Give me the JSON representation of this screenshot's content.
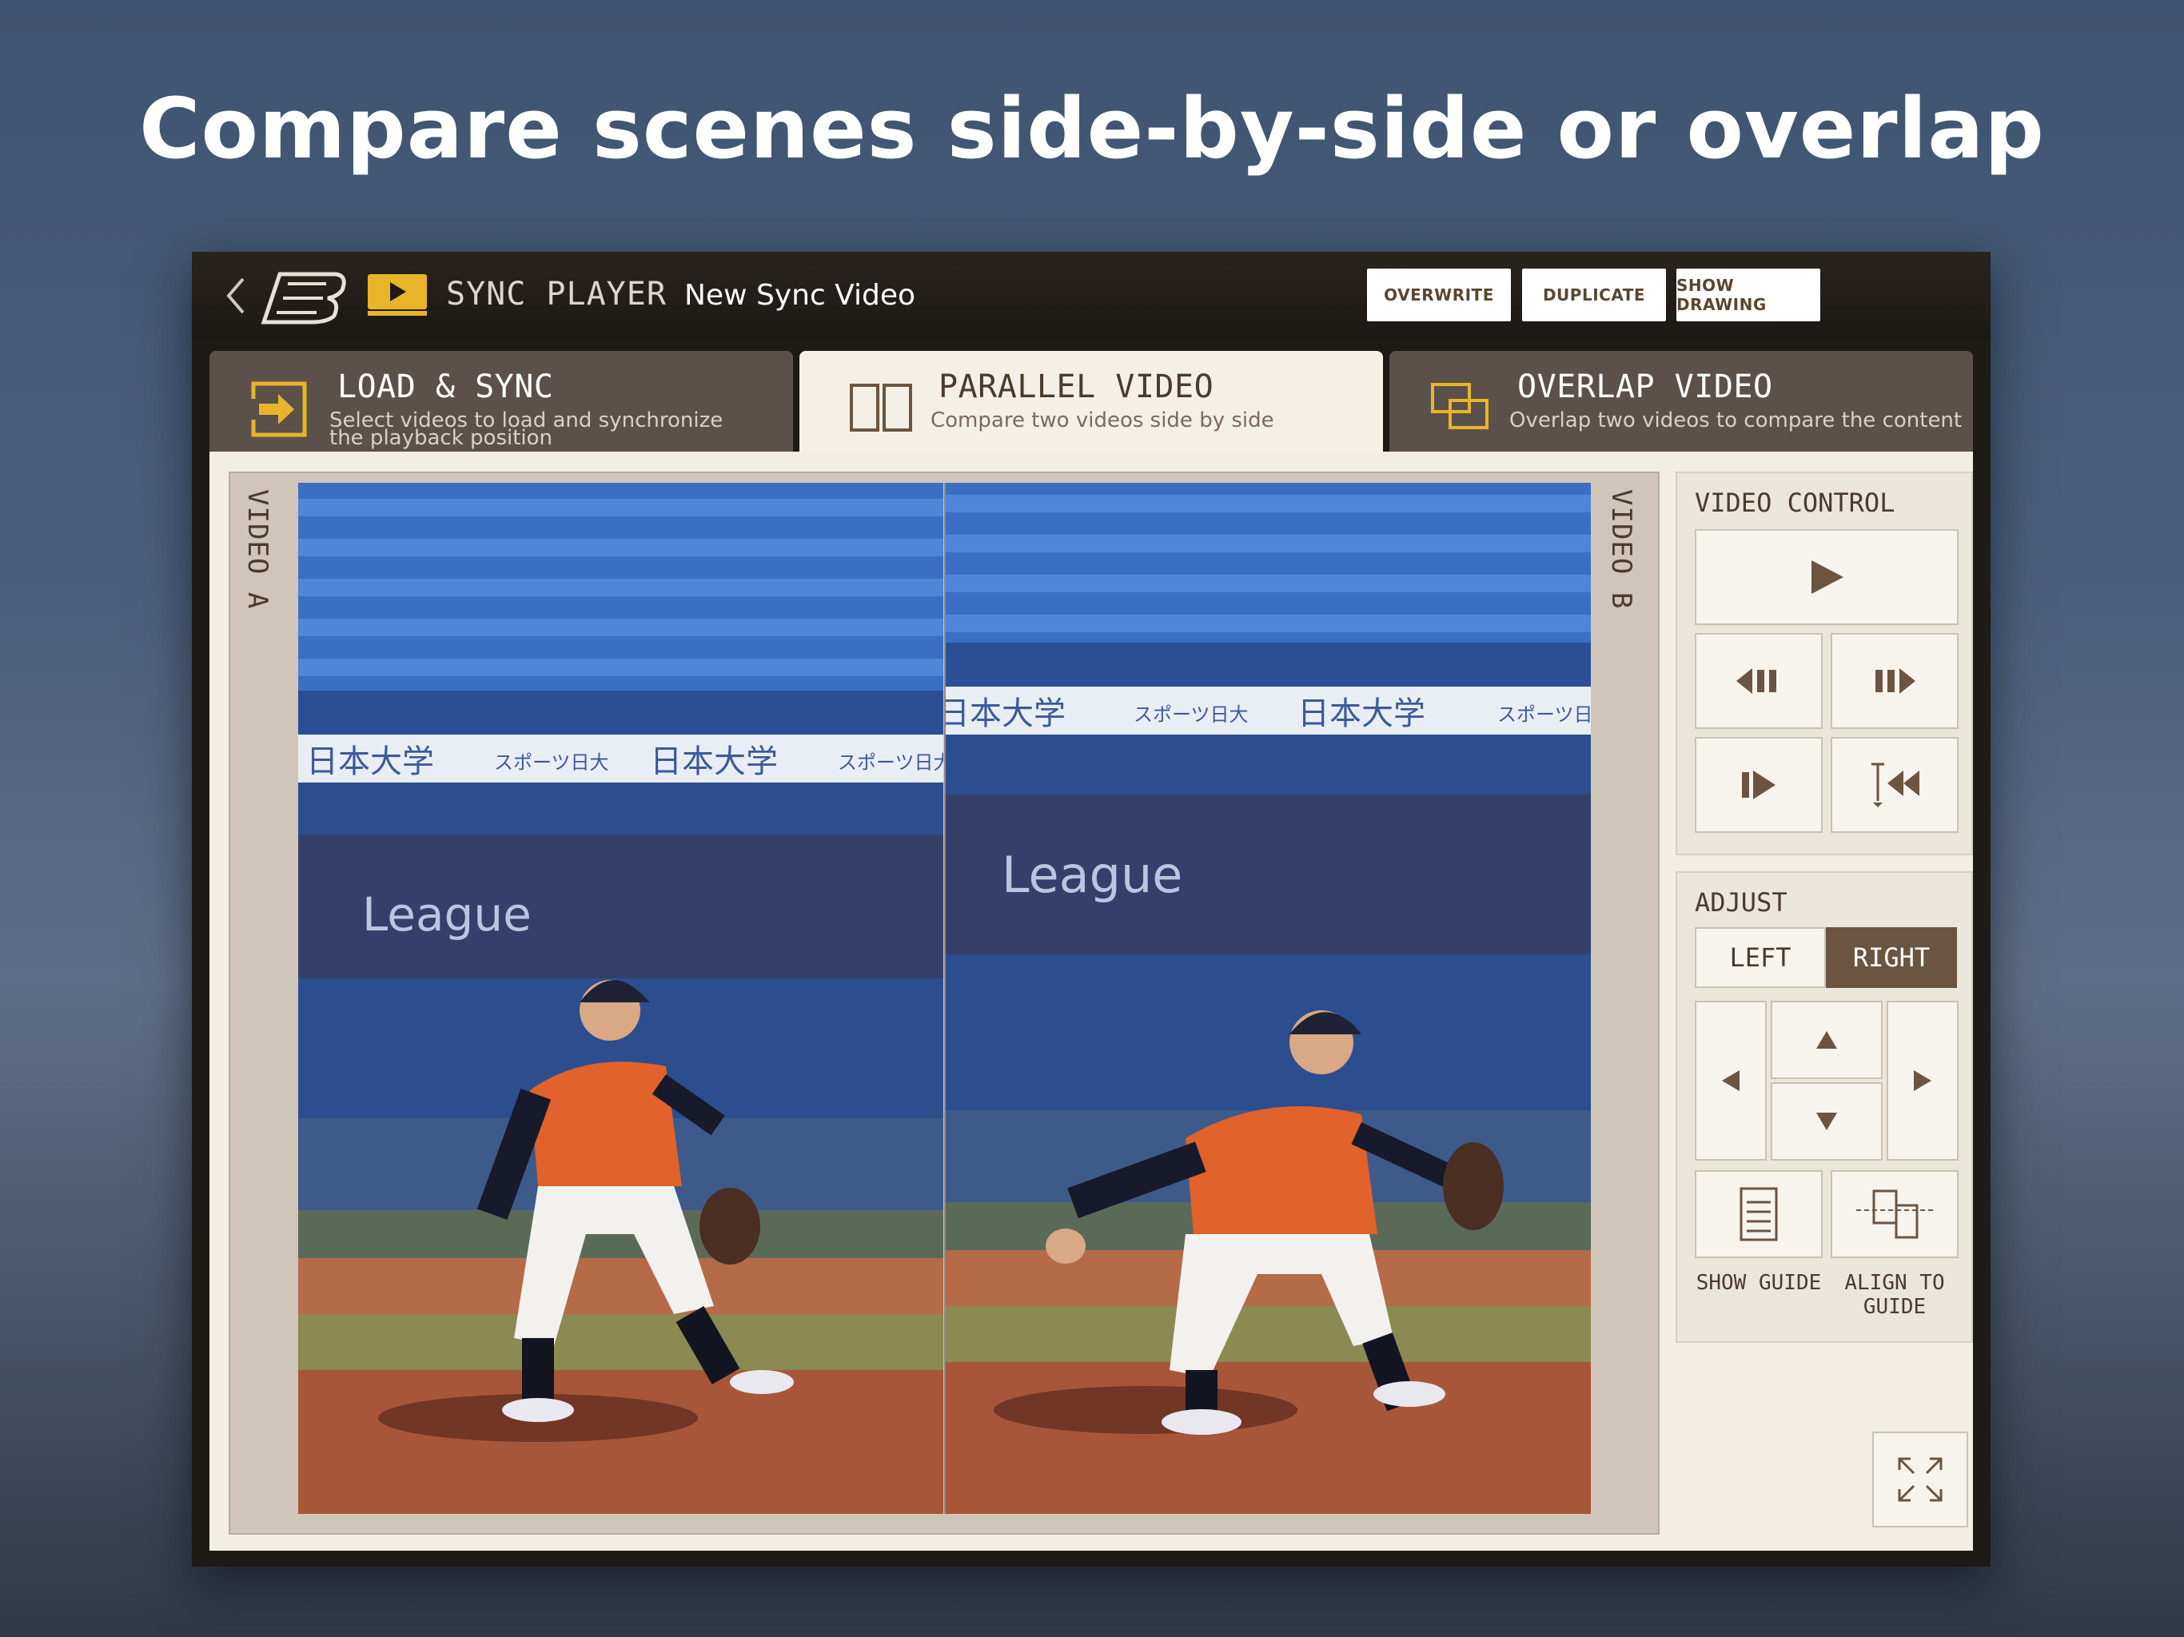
{
  "headline": "Compare scenes side-by-side or overlap",
  "topbar": {
    "app_title": "SYNC PLAYER",
    "document_title": "New Sync Video",
    "buttons": [
      "OVERWRITE",
      "DUPLICATE",
      "SHOW DRAWING"
    ]
  },
  "tabs": [
    {
      "title": "LOAD & SYNC",
      "subtitle_line1": "Select videos to load and synchronize",
      "subtitle_line2": "the playback position",
      "active": false
    },
    {
      "title": "PARALLEL VIDEO",
      "subtitle_line1": "Compare two videos side by side",
      "subtitle_line2": "",
      "active": true
    },
    {
      "title": "OVERLAP VIDEO",
      "subtitle_line1": "Overlap two videos to compare the content",
      "subtitle_line2": "",
      "active": false
    }
  ],
  "videos": {
    "a_label": "VIDEO A",
    "b_label": "VIDEO B",
    "banner_text": "日本大学",
    "banner_sub": "スポーツ日大",
    "league_text": "League"
  },
  "video_control": {
    "title": "VIDEO CONTROL"
  },
  "adjust": {
    "title": "ADJUST",
    "left_label": "LEFT",
    "right_label": "RIGHT",
    "selected": "RIGHT",
    "show_guide_label": "SHOW GUIDE",
    "align_guide_label": "ALIGN TO GUIDE"
  },
  "colors": {
    "accent_gold": "#e8b52a",
    "brown": "#6b5540",
    "panel_bg": "#f2eee4"
  }
}
